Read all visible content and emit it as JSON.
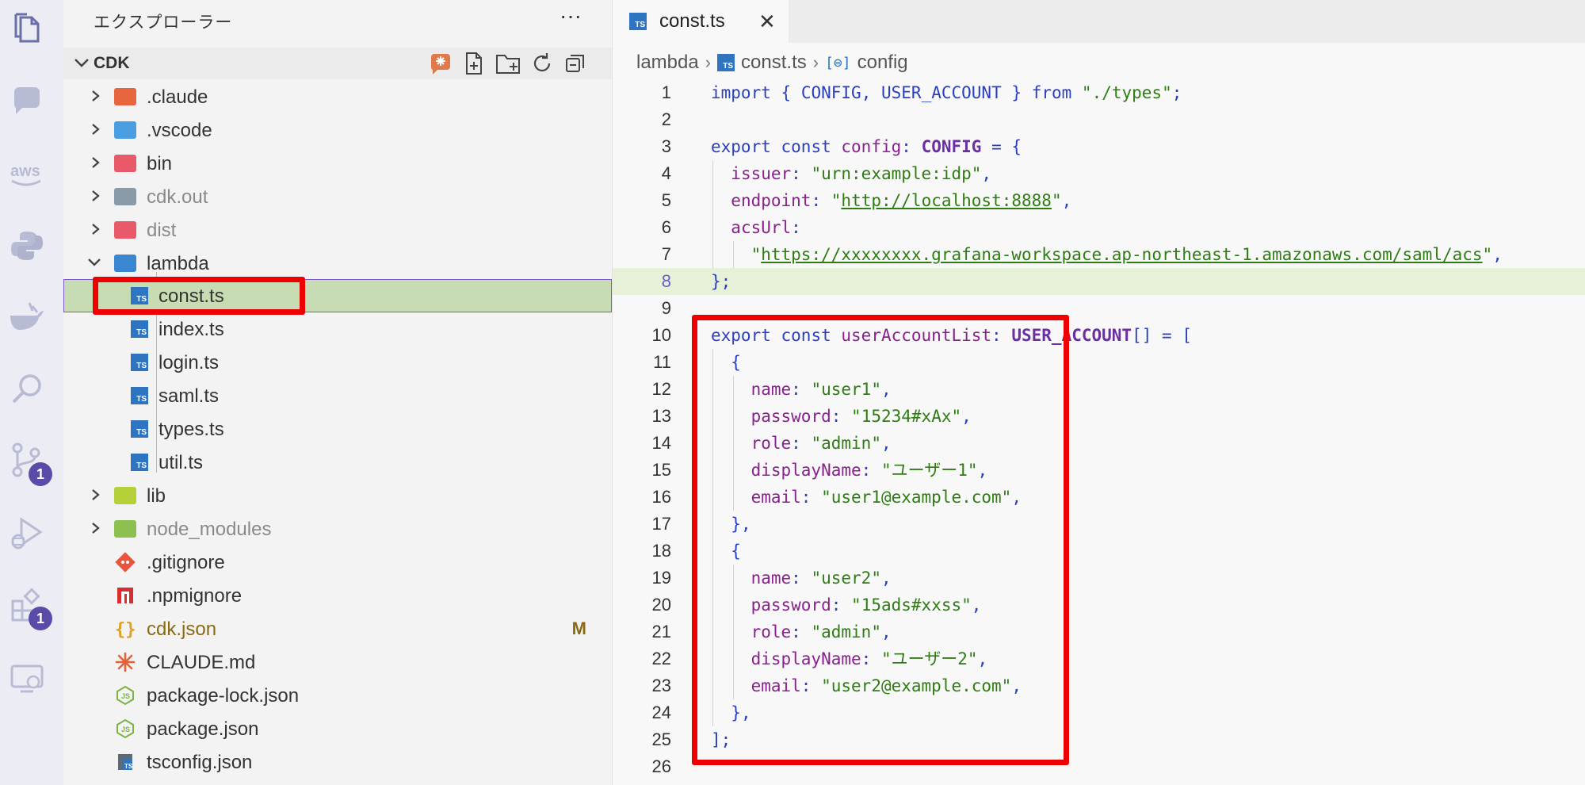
{
  "activity_bar": {
    "items": [
      {
        "icon": "files-icon"
      },
      {
        "icon": "chat-icon"
      },
      {
        "icon": "aws-icon",
        "label": "aws"
      },
      {
        "icon": "python-icon"
      },
      {
        "icon": "docker-icon"
      },
      {
        "icon": "search-icon"
      },
      {
        "icon": "source-control-icon",
        "badge": "1"
      },
      {
        "icon": "run-debug-icon"
      },
      {
        "icon": "extensions-icon",
        "badge": "1"
      },
      {
        "icon": "remote-explorer-icon"
      }
    ]
  },
  "explorer": {
    "title": "エクスプローラー",
    "more_label": "···",
    "section": "CDK",
    "tree": [
      {
        "name": ".claude",
        "kind": "folder",
        "color": "#e8663d"
      },
      {
        "name": ".vscode",
        "kind": "folder",
        "color": "#4a9de0"
      },
      {
        "name": "bin",
        "kind": "folder",
        "color": "#e85a6a"
      },
      {
        "name": "cdk.out",
        "kind": "folder",
        "color": "#8a9ba8"
      },
      {
        "name": "dist",
        "kind": "folder",
        "color": "#e85a6a"
      },
      {
        "name": "lambda",
        "kind": "folder-open",
        "color": "#3a86d0"
      },
      {
        "name": "const.ts",
        "kind": "ts",
        "selected": true
      },
      {
        "name": "index.ts",
        "kind": "ts"
      },
      {
        "name": "login.ts",
        "kind": "ts"
      },
      {
        "name": "saml.ts",
        "kind": "ts"
      },
      {
        "name": "types.ts",
        "kind": "ts"
      },
      {
        "name": "util.ts",
        "kind": "ts"
      },
      {
        "name": "lib",
        "kind": "folder",
        "color": "#b5d13a"
      },
      {
        "name": "node_modules",
        "kind": "folder",
        "color": "#8cc152"
      },
      {
        "name": ".gitignore",
        "kind": "git"
      },
      {
        "name": ".npmignore",
        "kind": "npm"
      },
      {
        "name": "cdk.json",
        "kind": "json",
        "status": "M"
      },
      {
        "name": "CLAUDE.md",
        "kind": "claude"
      },
      {
        "name": "package-lock.json",
        "kind": "node"
      },
      {
        "name": "package.json",
        "kind": "node"
      },
      {
        "name": "tsconfig.json",
        "kind": "tsconfig"
      }
    ]
  },
  "editor": {
    "tab": {
      "label": "const.ts",
      "close": "✕"
    },
    "breadcrumb": [
      "lambda",
      "const.ts",
      "config"
    ],
    "current_line": 8,
    "lines": [
      "import { CONFIG, USER_ACCOUNT } from \"./types\";",
      "",
      "export const config: CONFIG = {",
      "  issuer: \"urn:example:idp\",",
      "  endpoint: \"http://localhost:8888\",",
      "  acsUrl:",
      "    \"https://xxxxxxxx.grafana-workspace.ap-northeast-1.amazonaws.com/saml/acs\",",
      "};",
      "",
      "export const userAccountList: USER_ACCOUNT[] = [",
      "  {",
      "    name: \"user1\",",
      "    password: \"15234#xAx\",",
      "    role: \"admin\",",
      "    displayName: \"ユーザー1\",",
      "    email: \"user1@example.com\",",
      "  },",
      "  {",
      "    name: \"user2\",",
      "    password: \"15ads#xxss\",",
      "    role: \"admin\",",
      "    displayName: \"ユーザー2\",",
      "    email: \"user2@example.com\",",
      "  },",
      "];",
      ""
    ]
  },
  "colors": {
    "highlight_box": "#ee0000",
    "selection": "#c7dcb2",
    "keyword": "#2a3ec2",
    "type": "#6b2fa1",
    "string": "#2d7d12",
    "property": "#8a1f8f"
  }
}
